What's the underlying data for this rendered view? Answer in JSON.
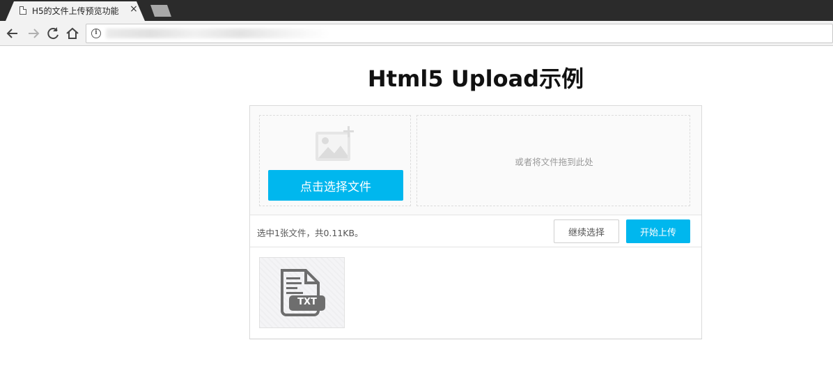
{
  "browser": {
    "tab_title": "H5的文件上传预览功能",
    "tab_close": "×"
  },
  "page": {
    "title": "Html5 Upload示例"
  },
  "uploader": {
    "pick_button": "点击选择文件",
    "drop_hint": "或者将文件拖到此处",
    "status_text": "选中1张文件，共0.11KB。",
    "continue_button": "继续选择",
    "start_button": "开始上传",
    "files": [
      {
        "type_label": "TXT",
        "icon": "txt-file-icon"
      }
    ]
  },
  "colors": {
    "accent": "#00b7ee"
  }
}
